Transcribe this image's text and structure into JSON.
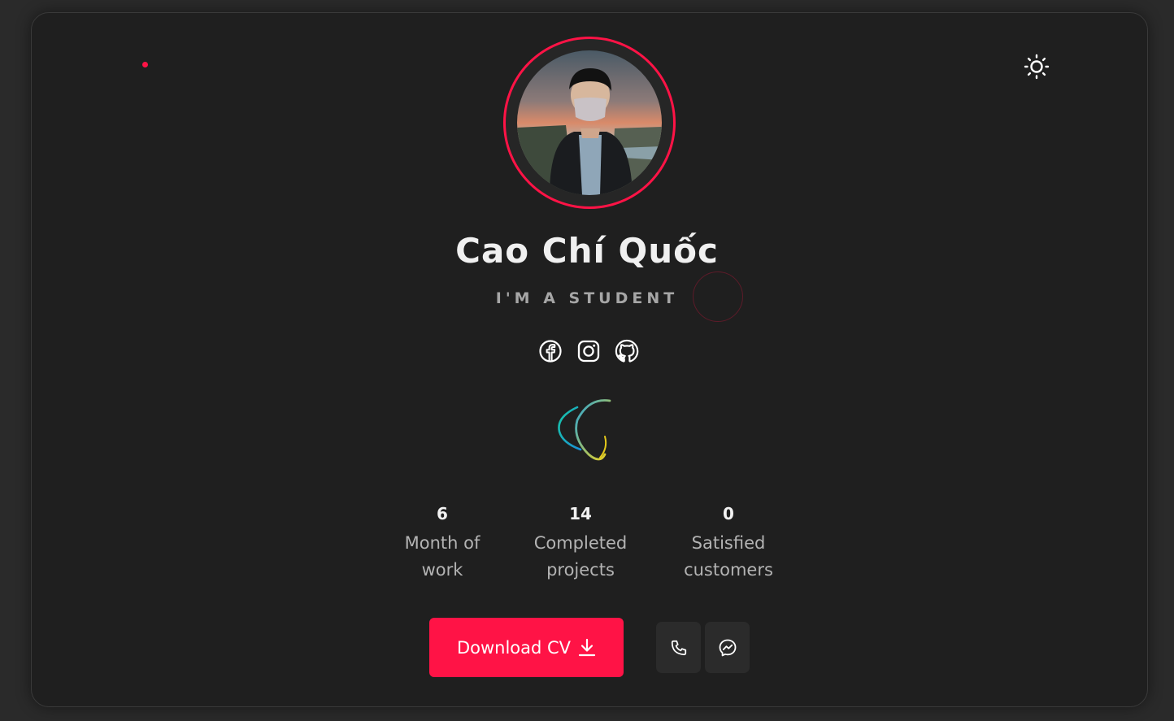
{
  "profile": {
    "name": "Cao Chí Quốc",
    "role": "I'M A STUDENT"
  },
  "socials": [
    {
      "icon": "facebook-icon"
    },
    {
      "icon": "instagram-icon"
    },
    {
      "icon": "github-icon"
    }
  ],
  "stats": [
    {
      "value": "6",
      "label": "Month of\nwork"
    },
    {
      "value": "14",
      "label": "Completed\nprojects"
    },
    {
      "value": "0",
      "label": "Satisfied\ncustomers"
    }
  ],
  "actions": {
    "download_label": "Download CV",
    "download_icon": "download-icon",
    "phone_icon": "phone-icon",
    "messenger_icon": "messenger-icon"
  },
  "theme": {
    "icon": "sun-icon",
    "accent": "#ff1346",
    "background": "#1f1f1f"
  }
}
